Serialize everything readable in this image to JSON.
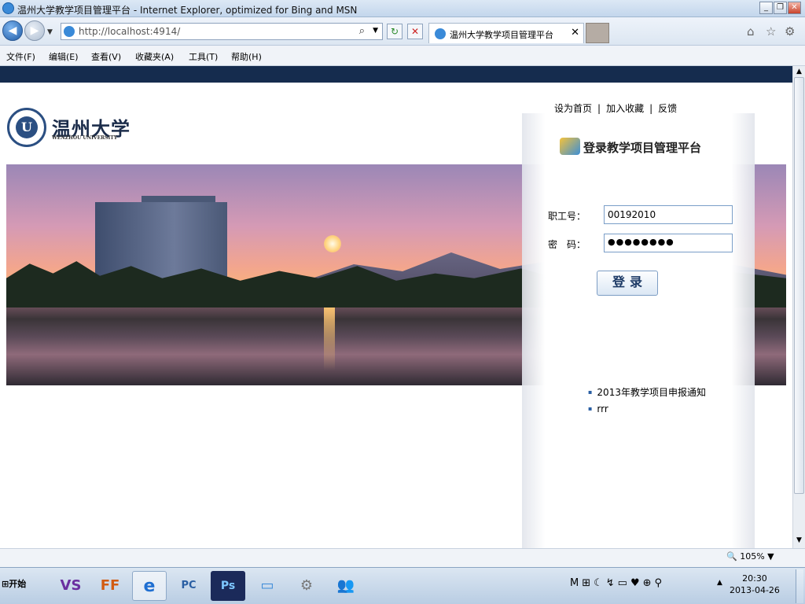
{
  "window": {
    "title": "温州大学教学项目管理平台 - Internet Explorer, optimized for Bing and MSN",
    "minimize": "_",
    "restore": "❐",
    "close": "✕"
  },
  "address_bar": {
    "back_icon": "◀",
    "forward_icon": "▶",
    "url": "http://localhost:4914/",
    "search_glyph": "⌕",
    "refresh_glyph": "↻",
    "stop_glyph": "✕"
  },
  "tab": {
    "title": "温州大学教学项目管理平台",
    "close": "✕"
  },
  "right_icons": [
    "⌂",
    "☆",
    "⚙"
  ],
  "menu": [
    "文件(F)",
    "编辑(E)",
    "查看(V)",
    "收藏夹(A)",
    "工具(T)",
    "帮助(H)"
  ],
  "logo": {
    "name_cn": "温州大学",
    "name_en": "WENZHOU UNIVERSITY",
    "emblem_letter": "U"
  },
  "top_links": [
    "设为首页",
    "加入收藏",
    "反馈"
  ],
  "top_links_separator": "|",
  "login": {
    "title": "登录教学项目管理平台",
    "staff_label": "职工号：",
    "staff_value": "00192010",
    "password_label": "密　码：",
    "password_value": "●●●●●●●●",
    "button": "登录"
  },
  "news": [
    "2013年教学项目申报通知",
    "rrr"
  ],
  "status": {
    "zoom": "105%"
  },
  "taskbar": {
    "start": "开始",
    "apps": [
      "VS",
      "FF",
      "e",
      "PC",
      "Ps",
      "▭",
      "⚙",
      "👥"
    ],
    "time": "20:30",
    "date": "2013-04-26"
  },
  "colors": {
    "header_strip": "#152c4e",
    "logo_blue": "#2b4f82"
  }
}
